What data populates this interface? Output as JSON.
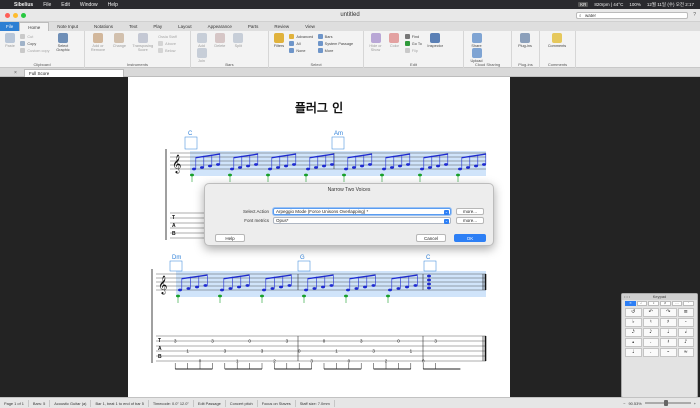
{
  "menubar": {
    "apple": "",
    "app_name": "Sibelius",
    "items": [
      "File",
      "Edit",
      "Window",
      "Help"
    ],
    "status": [
      "KR",
      "820rpm | 44°C",
      "100%",
      "12월 11일 (수) 오전 2:17"
    ]
  },
  "window": {
    "title": "untitled",
    "search_value": "water",
    "help_glyph": "?"
  },
  "ribbon": {
    "tabs": [
      "File",
      "Home",
      "Note Input",
      "Notations",
      "Text",
      "Play",
      "Layout",
      "Appearance",
      "Parts",
      "Review",
      "View"
    ],
    "active_tab": "Home",
    "groups": {
      "clipboard": {
        "label": "Clipboard",
        "paste": "Paste",
        "cut": "Cut",
        "copy": "Copy",
        "custom_copy": "Custom copy",
        "select_graphic": "Select Graphic"
      },
      "instruments": {
        "label": "Instruments",
        "add_remove": "Add or Remove",
        "change": "Change",
        "transposing_score": "Transposing Score",
        "staff_options": [
          "Ossia Staff",
          "Above",
          "Below"
        ]
      },
      "bars": {
        "label": "Bars",
        "items": [
          "Add",
          "Delete",
          "Split",
          "Join"
        ]
      },
      "select": {
        "label": "Select",
        "filters": "Filters",
        "small": [
          "Advanced",
          "All",
          "None",
          "Bars",
          "System Passage",
          "More"
        ]
      },
      "edit": {
        "label": "Edit",
        "items": [
          "Hide or Show",
          "Color",
          "Find",
          "Go To",
          "Flip",
          "Inspector"
        ]
      },
      "cloud": {
        "label": "Cloud Sharing",
        "items": [
          "Share",
          "Upload"
        ]
      },
      "plugins": {
        "label": "Plug-ins",
        "items": [
          "Plug-ins"
        ]
      },
      "comments": {
        "label": "Comments",
        "items": [
          "Comments"
        ]
      }
    }
  },
  "document": {
    "tab_label": "Full Score",
    "close_glyph": "×"
  },
  "score": {
    "title": "플러그 인",
    "chords_system1": [
      "C",
      "Am"
    ],
    "chords_system2": [
      "Dm",
      "G",
      "C"
    ],
    "tab_label": [
      "T",
      "A",
      "B"
    ],
    "tab_numbers_system2": [
      "3",
      "1",
      "0",
      "3",
      "3",
      "1",
      "0",
      "3",
      "2",
      "3",
      "0",
      "3",
      "0",
      "1",
      "0",
      "3",
      "3",
      "2",
      "0",
      "1",
      "0",
      "3"
    ]
  },
  "dialog": {
    "title": "Narrow Two Voices",
    "select_action_label": "Select Action",
    "select_action_value": "Arpeggio Mode (Force Unisons Overlapping) *",
    "font_metrics_label": "Font metrics",
    "font_metrics_value": "Opus*",
    "more_label": "more...",
    "help_label": "Help",
    "cancel_label": "Cancel",
    "ok_label": "OK"
  },
  "keypad": {
    "title": "Keypad",
    "tabs": [
      "≡",
      "♩",
      "♪",
      "♬",
      "…",
      "·"
    ],
    "keys": [
      "↺",
      "↶",
      "↷",
      "≡",
      "♭",
      "♮",
      "♯",
      "-",
      "𝅘𝅥𝅯",
      "𝅘𝅥𝅮",
      "♩",
      "𝅗𝅥",
      "𝅝",
      ".",
      "𝄽",
      "♪",
      "♩",
      ".",
      "𝄼",
      "≈"
    ]
  },
  "statusbar": {
    "cells": [
      "Page 1 of 1",
      "Bars: 5",
      "Acoustic Guitar (a)",
      "Bar 1, beat 1 to end of bar 5",
      "Timecode: 0.0\" 12.0\"",
      "Edit Passage",
      "Concert pitch",
      "Focus on Staves",
      "Staff size: 7.0mm"
    ],
    "zoom": "90.53%",
    "zoom_fraction": 0.45
  },
  "colors": {
    "accent": "#2d7ff5",
    "selection": "#9fc8f5",
    "note_blue": "#1e2bd0",
    "note_green": "#18a02b",
    "chord_blue": "#2f80d8"
  }
}
